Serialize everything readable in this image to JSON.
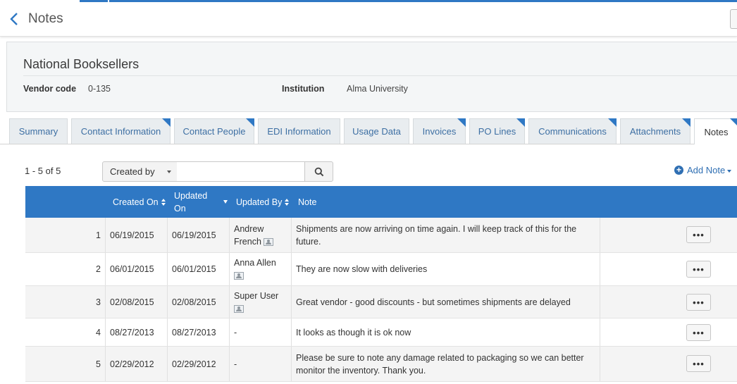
{
  "header": {
    "title": "Notes"
  },
  "vendor": {
    "name": "National Booksellers",
    "vendor_code_label": "Vendor code",
    "vendor_code_value": "0-135",
    "institution_label": "Institution",
    "institution_value": "Alma University"
  },
  "tabs": [
    {
      "label": "Summary",
      "active": false,
      "corner": false
    },
    {
      "label": "Contact Information",
      "active": false,
      "corner": true
    },
    {
      "label": "Contact People",
      "active": false,
      "corner": true
    },
    {
      "label": "EDI Information",
      "active": false,
      "corner": false
    },
    {
      "label": "Usage Data",
      "active": false,
      "corner": false
    },
    {
      "label": "Invoices",
      "active": false,
      "corner": true
    },
    {
      "label": "PO Lines",
      "active": false,
      "corner": true
    },
    {
      "label": "Communications",
      "active": false,
      "corner": true
    },
    {
      "label": "Attachments",
      "active": false,
      "corner": true
    },
    {
      "label": "Notes",
      "active": true,
      "corner": true
    }
  ],
  "toolbar": {
    "count": "1 - 5 of 5",
    "filter_selected": "Created by",
    "search_value": "",
    "add_note_label": "Add Note"
  },
  "table": {
    "columns": {
      "created_on": "Created On",
      "updated_on_line1": "Updated",
      "updated_on_line2": "On",
      "updated_by": "Updated By",
      "note": "Note"
    },
    "row_action_label": "•••",
    "rows": [
      {
        "index": "1",
        "created_on": "06/19/2015",
        "updated_on": "06/19/2015",
        "updated_by_line1": "Andrew",
        "updated_by_line2": "French",
        "note_line1": "Shipments are now arriving on time again. I will keep track of this for the",
        "note_line2": "future."
      },
      {
        "index": "2",
        "created_on": "06/01/2015",
        "updated_on": "06/01/2015",
        "updated_by_line1": "Anna Allen",
        "updated_by_line2": "",
        "note_line1": "They are now slow with deliveries",
        "note_line2": ""
      },
      {
        "index": "3",
        "created_on": "02/08/2015",
        "updated_on": "02/08/2015",
        "updated_by_line1": "Super User",
        "updated_by_line2": "",
        "note_line1": "Great vendor - good discounts - but sometimes shipments are delayed",
        "note_line2": ""
      },
      {
        "index": "4",
        "created_on": "08/27/2013",
        "updated_on": "08/27/2013",
        "updated_by_line1": "-",
        "updated_by_line2": "",
        "note_line1": "It looks as though it is ok now",
        "note_line2": ""
      },
      {
        "index": "5",
        "created_on": "02/29/2012",
        "updated_on": "02/29/2012",
        "updated_by_line1": "-",
        "updated_by_line2": "",
        "note_line1": "Please be sure to note any damage related to packaging so we can better",
        "note_line2": "monitor the inventory. Thank you."
      }
    ]
  }
}
